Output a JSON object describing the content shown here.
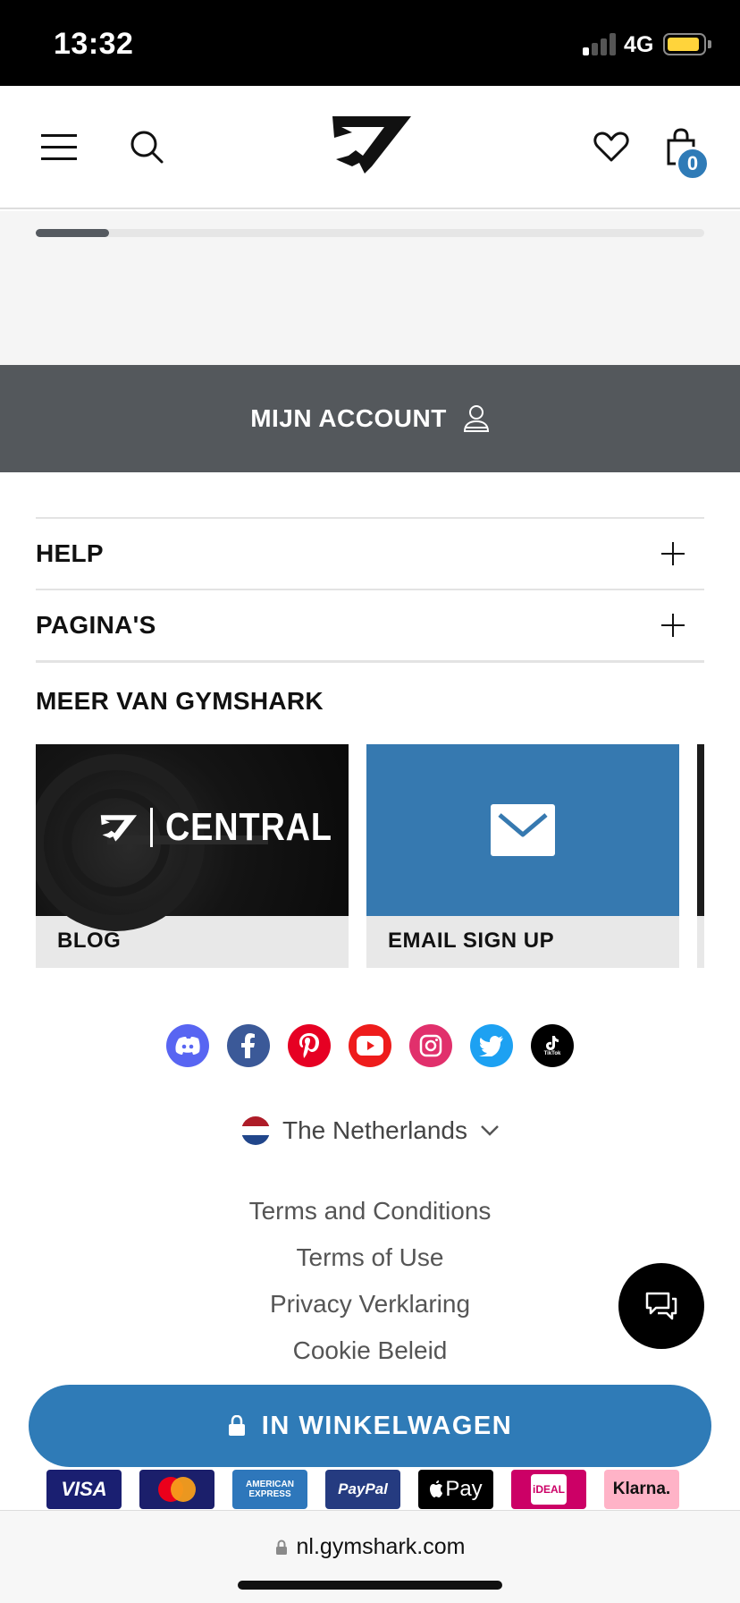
{
  "status_bar": {
    "time": "13:32",
    "network": "4G"
  },
  "header": {
    "cart_count": "0"
  },
  "product_scroll": {
    "progress": 0.11
  },
  "account": {
    "label": "MIJN ACCOUNT"
  },
  "accordions": [
    {
      "label": "HELP"
    },
    {
      "label": "PAGINA'S"
    }
  ],
  "more_section": {
    "title": "MEER VAN GYMSHARK",
    "cards": [
      {
        "label": "BLOG",
        "image_text": "CENTRAL"
      },
      {
        "label": "EMAIL SIGN UP"
      }
    ]
  },
  "socials": [
    {
      "name": "discord-icon",
      "color": "#5865f2"
    },
    {
      "name": "facebook-icon",
      "color": "#3b5998"
    },
    {
      "name": "pinterest-icon",
      "color": "#e60023"
    },
    {
      "name": "youtube-icon",
      "color": "#ff0000"
    },
    {
      "name": "instagram-icon",
      "color": "#e1306c"
    },
    {
      "name": "twitter-icon",
      "color": "#1da1f2"
    },
    {
      "name": "tiktok-icon",
      "color": "#000000",
      "text": "TikTok"
    }
  ],
  "country": {
    "name": "The Netherlands"
  },
  "footer_links": [
    "Terms and Conditions",
    "Terms of Use",
    "Privacy Verklaring",
    "Cookie Beleid"
  ],
  "cta": {
    "label": "IN WINKELWAGEN"
  },
  "payments": [
    {
      "name": "VISA",
      "bg": "#1a1f71"
    },
    {
      "name": "mastercard-icon",
      "bg": "#1b1f6b"
    },
    {
      "name": "AMERICAN EXPRESS",
      "bg": "#2e77bb"
    },
    {
      "name": "PayPal",
      "bg": "#253b80"
    },
    {
      "name": "Pay",
      "bg": "#000000"
    },
    {
      "name": "iDEAL",
      "bg": "#cc0066"
    },
    {
      "name": "Klarna.",
      "bg": "#ffb3c7"
    }
  ],
  "browser": {
    "url": "nl.gymshark.com"
  },
  "colors": {
    "accent": "#2f7bb7",
    "account_bar": "#54585c"
  }
}
